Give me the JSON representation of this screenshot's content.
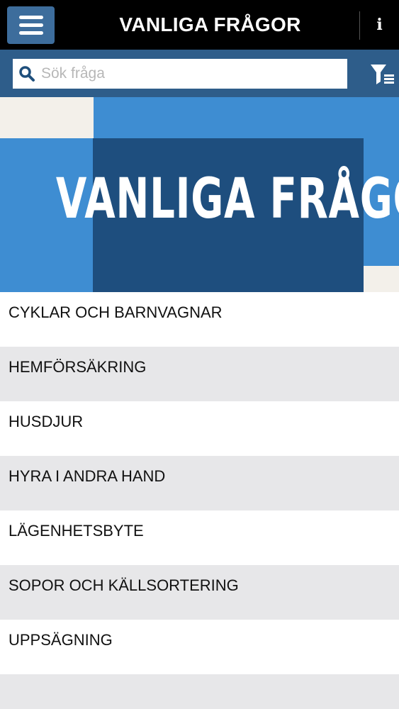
{
  "header": {
    "title": "VANLIGA FRÅGOR",
    "info_label": "i"
  },
  "search": {
    "placeholder": "Sök fråga",
    "value": ""
  },
  "banner": {
    "text": "VANLIGA FRÅGOR"
  },
  "categories": [
    "CYKLAR OCH BARNVAGNAR",
    "HEMFÖRSÄKRING",
    "HUSDJUR",
    "HYRA I ANDRA HAND",
    "LÄGENHETSBYTE",
    "SOPOR OCH KÄLLSORTERING",
    "UPPSÄGNING"
  ],
  "icons": {
    "menu": "hamburger-icon",
    "search": "search-icon",
    "filter": "filter-list-icon"
  },
  "colors": {
    "topbar": "#000000",
    "menu_button": "#3d6d9c",
    "searchbar": "#2e5d8a",
    "banner_light": "#3e8dd2",
    "banner_dark": "#1e4e7e",
    "row_alt": "#e7e7e9"
  }
}
